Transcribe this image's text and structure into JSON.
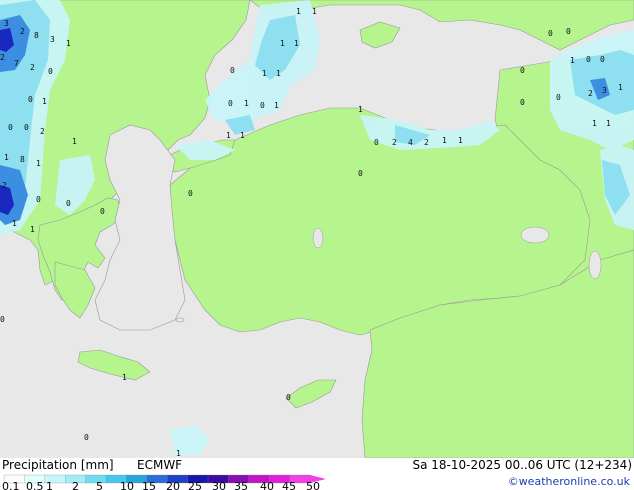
{
  "header": {
    "title": "Precipitation [mm]",
    "model": "ECMWF",
    "timestamp": "Sa 18-10-2025 00..06 UTC (12+234)",
    "credit": "©weatheronline.co.uk"
  },
  "legend": {
    "ticks": [
      "0.1",
      "0.5",
      "1",
      "2",
      "5",
      "10",
      "15",
      "20",
      "25",
      "30",
      "35",
      "40",
      "45",
      "50"
    ],
    "colors": [
      "#fcfcfc",
      "#e0ffff",
      "#c6f5fb",
      "#a0ecf7",
      "#6fdcf3",
      "#44c8ee",
      "#2aa3dc",
      "#2a6ed8",
      "#1e40c8",
      "#1818a8",
      "#3c0ca0",
      "#8a0cb4",
      "#c414c8",
      "#e020d8",
      "#f040e8"
    ]
  },
  "colors": {
    "sea": "#e8e8e8",
    "land": "#b6f48e",
    "border": "#999999",
    "precip_light": "#c8f4f8",
    "precip_mid": "#8ee0f0",
    "precip_heavy": "#3c8ee0",
    "precip_max": "#1a28c0"
  },
  "map_labels": [
    {
      "t": "1"
    },
    {
      "t": "1"
    },
    {
      "t": "1"
    },
    {
      "t": "1"
    },
    {
      "t": "0"
    },
    {
      "t": "1"
    },
    {
      "t": "1"
    },
    {
      "t": "0"
    },
    {
      "t": "1"
    },
    {
      "t": "0"
    },
    {
      "t": "1"
    },
    {
      "t": "1"
    },
    {
      "t": "1"
    },
    {
      "t": "1"
    },
    {
      "t": "0"
    },
    {
      "t": "2"
    },
    {
      "t": "4"
    },
    {
      "t": "2"
    },
    {
      "t": "1"
    },
    {
      "t": "1"
    },
    {
      "t": "0"
    },
    {
      "t": "0"
    },
    {
      "t": "0"
    },
    {
      "t": "0"
    },
    {
      "t": "0"
    },
    {
      "t": "0"
    },
    {
      "t": "2"
    },
    {
      "t": "3"
    },
    {
      "t": "1"
    },
    {
      "t": "1"
    },
    {
      "t": "0"
    },
    {
      "t": "1"
    },
    {
      "t": "1"
    },
    {
      "t": "3"
    },
    {
      "t": "2"
    },
    {
      "t": "8"
    },
    {
      "t": "3"
    },
    {
      "t": "1"
    },
    {
      "t": "2"
    },
    {
      "t": "7"
    },
    {
      "t": "2"
    },
    {
      "t": "0"
    },
    {
      "t": "0"
    },
    {
      "t": "1"
    },
    {
      "t": "0"
    },
    {
      "t": "0"
    },
    {
      "t": "2"
    },
    {
      "t": "1"
    },
    {
      "t": "1"
    },
    {
      "t": "8"
    },
    {
      "t": "1"
    },
    {
      "t": "2"
    },
    {
      "t": "0"
    },
    {
      "t": "0"
    },
    {
      "t": "1"
    },
    {
      "t": "1"
    },
    {
      "t": "0"
    },
    {
      "t": "0"
    },
    {
      "t": "0"
    },
    {
      "t": "0"
    },
    {
      "t": "1"
    },
    {
      "t": "1"
    },
    {
      "t": "0"
    },
    {
      "t": "0"
    }
  ]
}
